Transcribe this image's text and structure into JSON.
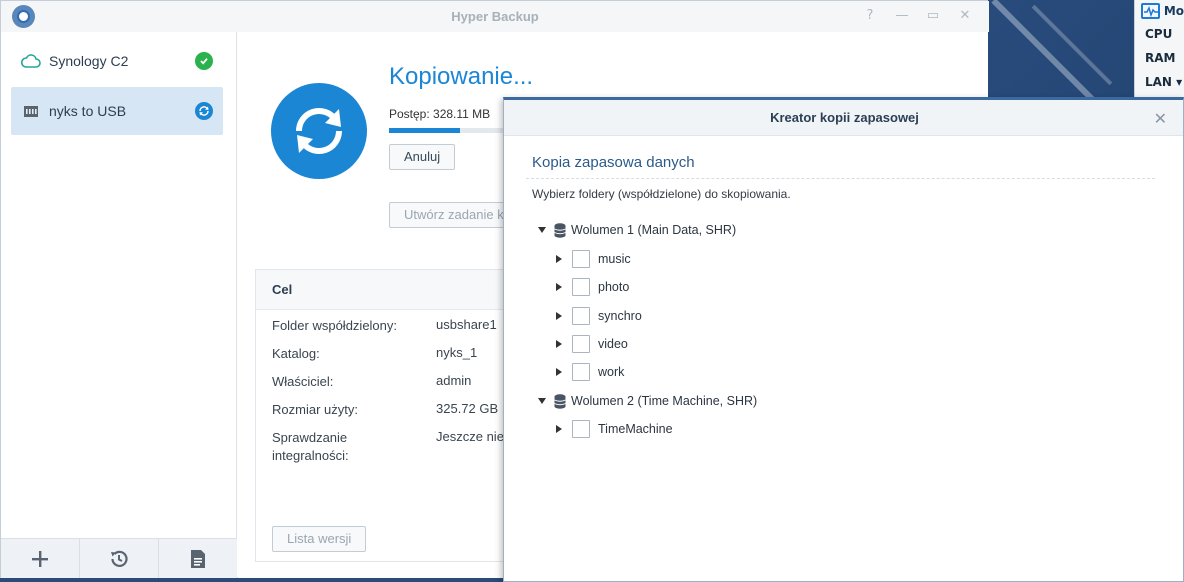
{
  "window": {
    "title": "Hyper Backup",
    "controls": [
      "?",
      "—",
      "▭",
      "✕"
    ]
  },
  "widget": {
    "title": "Mo",
    "rows": [
      "CPU",
      "RAM",
      "LAN ▾"
    ]
  },
  "sidebar": {
    "tasks": [
      {
        "label": "Synology C2",
        "icon": "cloud-icon",
        "status": "success"
      },
      {
        "label": "nyks to USB",
        "icon": "usb-drive-icon",
        "status": "running"
      }
    ],
    "bottom_actions": [
      "add",
      "restore-history",
      "log"
    ]
  },
  "main": {
    "status_title": "Kopiowanie...",
    "progress_text": "Postęp: 328.11 MB",
    "progress_fraction": 0.57,
    "cancel_label": "Anuluj",
    "create_task_label": "Utwórz zadanie k",
    "panel": {
      "title": "Cel",
      "rows": [
        {
          "key": "Folder współdzielony:",
          "value": "usbshare1"
        },
        {
          "key": "Katalog:",
          "value": "nyks_1"
        },
        {
          "key": "Właściciel:",
          "value": "admin"
        },
        {
          "key": "Rozmiar użyty:",
          "value": "325.72 GB"
        },
        {
          "key": "Sprawdzanie\nintegralności:",
          "value": "Jeszcze nie"
        }
      ],
      "versions_label": "Lista wersji"
    }
  },
  "dialog": {
    "title": "Kreator kopii zapasowej",
    "heading": "Kopia zapasowa danych",
    "description": "Wybierz foldery (współdzielone) do skopiowania.",
    "volumes": [
      {
        "label": "Wolumen 1 (Main Data, SHR)",
        "folders": [
          "music",
          "photo",
          "synchro",
          "video",
          "work"
        ]
      },
      {
        "label": "Wolumen 2 (Time Machine, SHR)",
        "folders": [
          "TimeMachine"
        ]
      }
    ]
  },
  "colors": {
    "accent": "#1b86d4",
    "success": "#2bb24c",
    "selected_row": "#d7e6f5"
  }
}
